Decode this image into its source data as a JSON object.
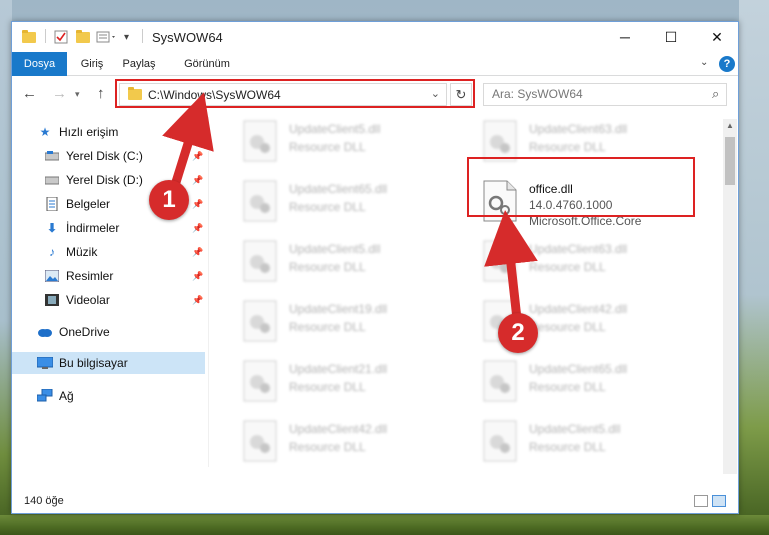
{
  "window": {
    "title": "SysWOW64",
    "controls": {
      "minimize": "─",
      "maximize": "☐",
      "close": "✕"
    }
  },
  "ribbon": {
    "tabs": [
      "Dosya",
      "Giriş",
      "Paylaş",
      "Görünüm"
    ],
    "help": "?"
  },
  "address": {
    "path": "C:\\Windows\\SysWOW64",
    "search_placeholder": "Ara: SysWOW64"
  },
  "sidebar": {
    "quick_access": "Hızlı erişim",
    "items": [
      {
        "label": "Yerel Disk (C:)",
        "icon": "drive-icon"
      },
      {
        "label": "Yerel Disk (D:)",
        "icon": "drive-icon"
      },
      {
        "label": "Belgeler",
        "icon": "documents-icon"
      },
      {
        "label": "İndirmeler",
        "icon": "downloads-icon"
      },
      {
        "label": "Müzik",
        "icon": "music-icon"
      },
      {
        "label": "Resimler",
        "icon": "pictures-icon"
      },
      {
        "label": "Videolar",
        "icon": "videos-icon"
      }
    ],
    "onedrive": "OneDrive",
    "this_pc": "Bu bilgisayar",
    "network": "Ağ"
  },
  "files": {
    "left_column": [
      {
        "name": "UpdateClient5.dll",
        "desc": "Resource DLL"
      },
      {
        "name": "UpdateClient65.dll",
        "desc": "Resource DLL"
      },
      {
        "name": "UpdateClient5.dll",
        "desc": "Resource DLL"
      },
      {
        "name": "UpdateClient19.dll",
        "desc": "Resource DLL"
      },
      {
        "name": "UpdateClient21.dll",
        "desc": "Resource DLL"
      },
      {
        "name": "UpdateClient42.dll",
        "desc": "Resource DLL"
      }
    ],
    "right_column": [
      {
        "name": "UpdateClient63.dll",
        "desc": "Resource DLL"
      },
      {
        "name": "UpdateClient63.dll",
        "desc": "Resource DLL"
      },
      {
        "name": "UpdateClient42.dll",
        "desc": "Resource DLL"
      },
      {
        "name": "UpdateClient65.dll",
        "desc": "Resource DLL"
      },
      {
        "name": "UpdateClient5.dll",
        "desc": "Resource DLL"
      }
    ],
    "highlighted": {
      "name": "office.dll",
      "version": "14.0.4760.1000",
      "company": "Microsoft.Office.Core"
    }
  },
  "status": {
    "count": "140 öğe"
  },
  "annotations": {
    "badge1": "1",
    "badge2": "2",
    "accent": "#d62b2b"
  }
}
